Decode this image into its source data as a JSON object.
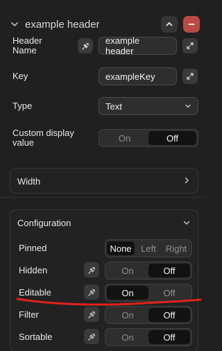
{
  "header": {
    "title": "example header",
    "collapse_icon": "chevron-down-icon",
    "up_icon": "chevron-up-icon",
    "remove_icon": "minus-icon"
  },
  "fields": {
    "header_name": {
      "label": "Header Name",
      "value": "example header"
    },
    "key": {
      "label": "Key",
      "value": "exampleKey"
    },
    "type": {
      "label": "Type",
      "value": "Text"
    },
    "custom_display": {
      "label": "Custom display value",
      "on": "On",
      "off": "Off",
      "selected": "Off"
    }
  },
  "width_section": {
    "title": "Width"
  },
  "configuration": {
    "title": "Configuration",
    "pinned": {
      "label": "Pinned",
      "options": [
        "None",
        "Left",
        "Right"
      ],
      "selected": "None"
    },
    "hidden": {
      "label": "Hidden",
      "on": "On",
      "off": "Off",
      "selected": "Off"
    },
    "editable": {
      "label": "Editable",
      "on": "On",
      "off": "Off",
      "selected": "On"
    },
    "filter": {
      "label": "Filter",
      "on": "On",
      "off": "Off",
      "selected": "Off"
    },
    "sortable": {
      "label": "Sortable",
      "on": "On",
      "off": "Off",
      "selected": "Off"
    }
  },
  "colors": {
    "background": "#202020",
    "remove_button": "#b94b44",
    "annotation": "#e0221c"
  }
}
